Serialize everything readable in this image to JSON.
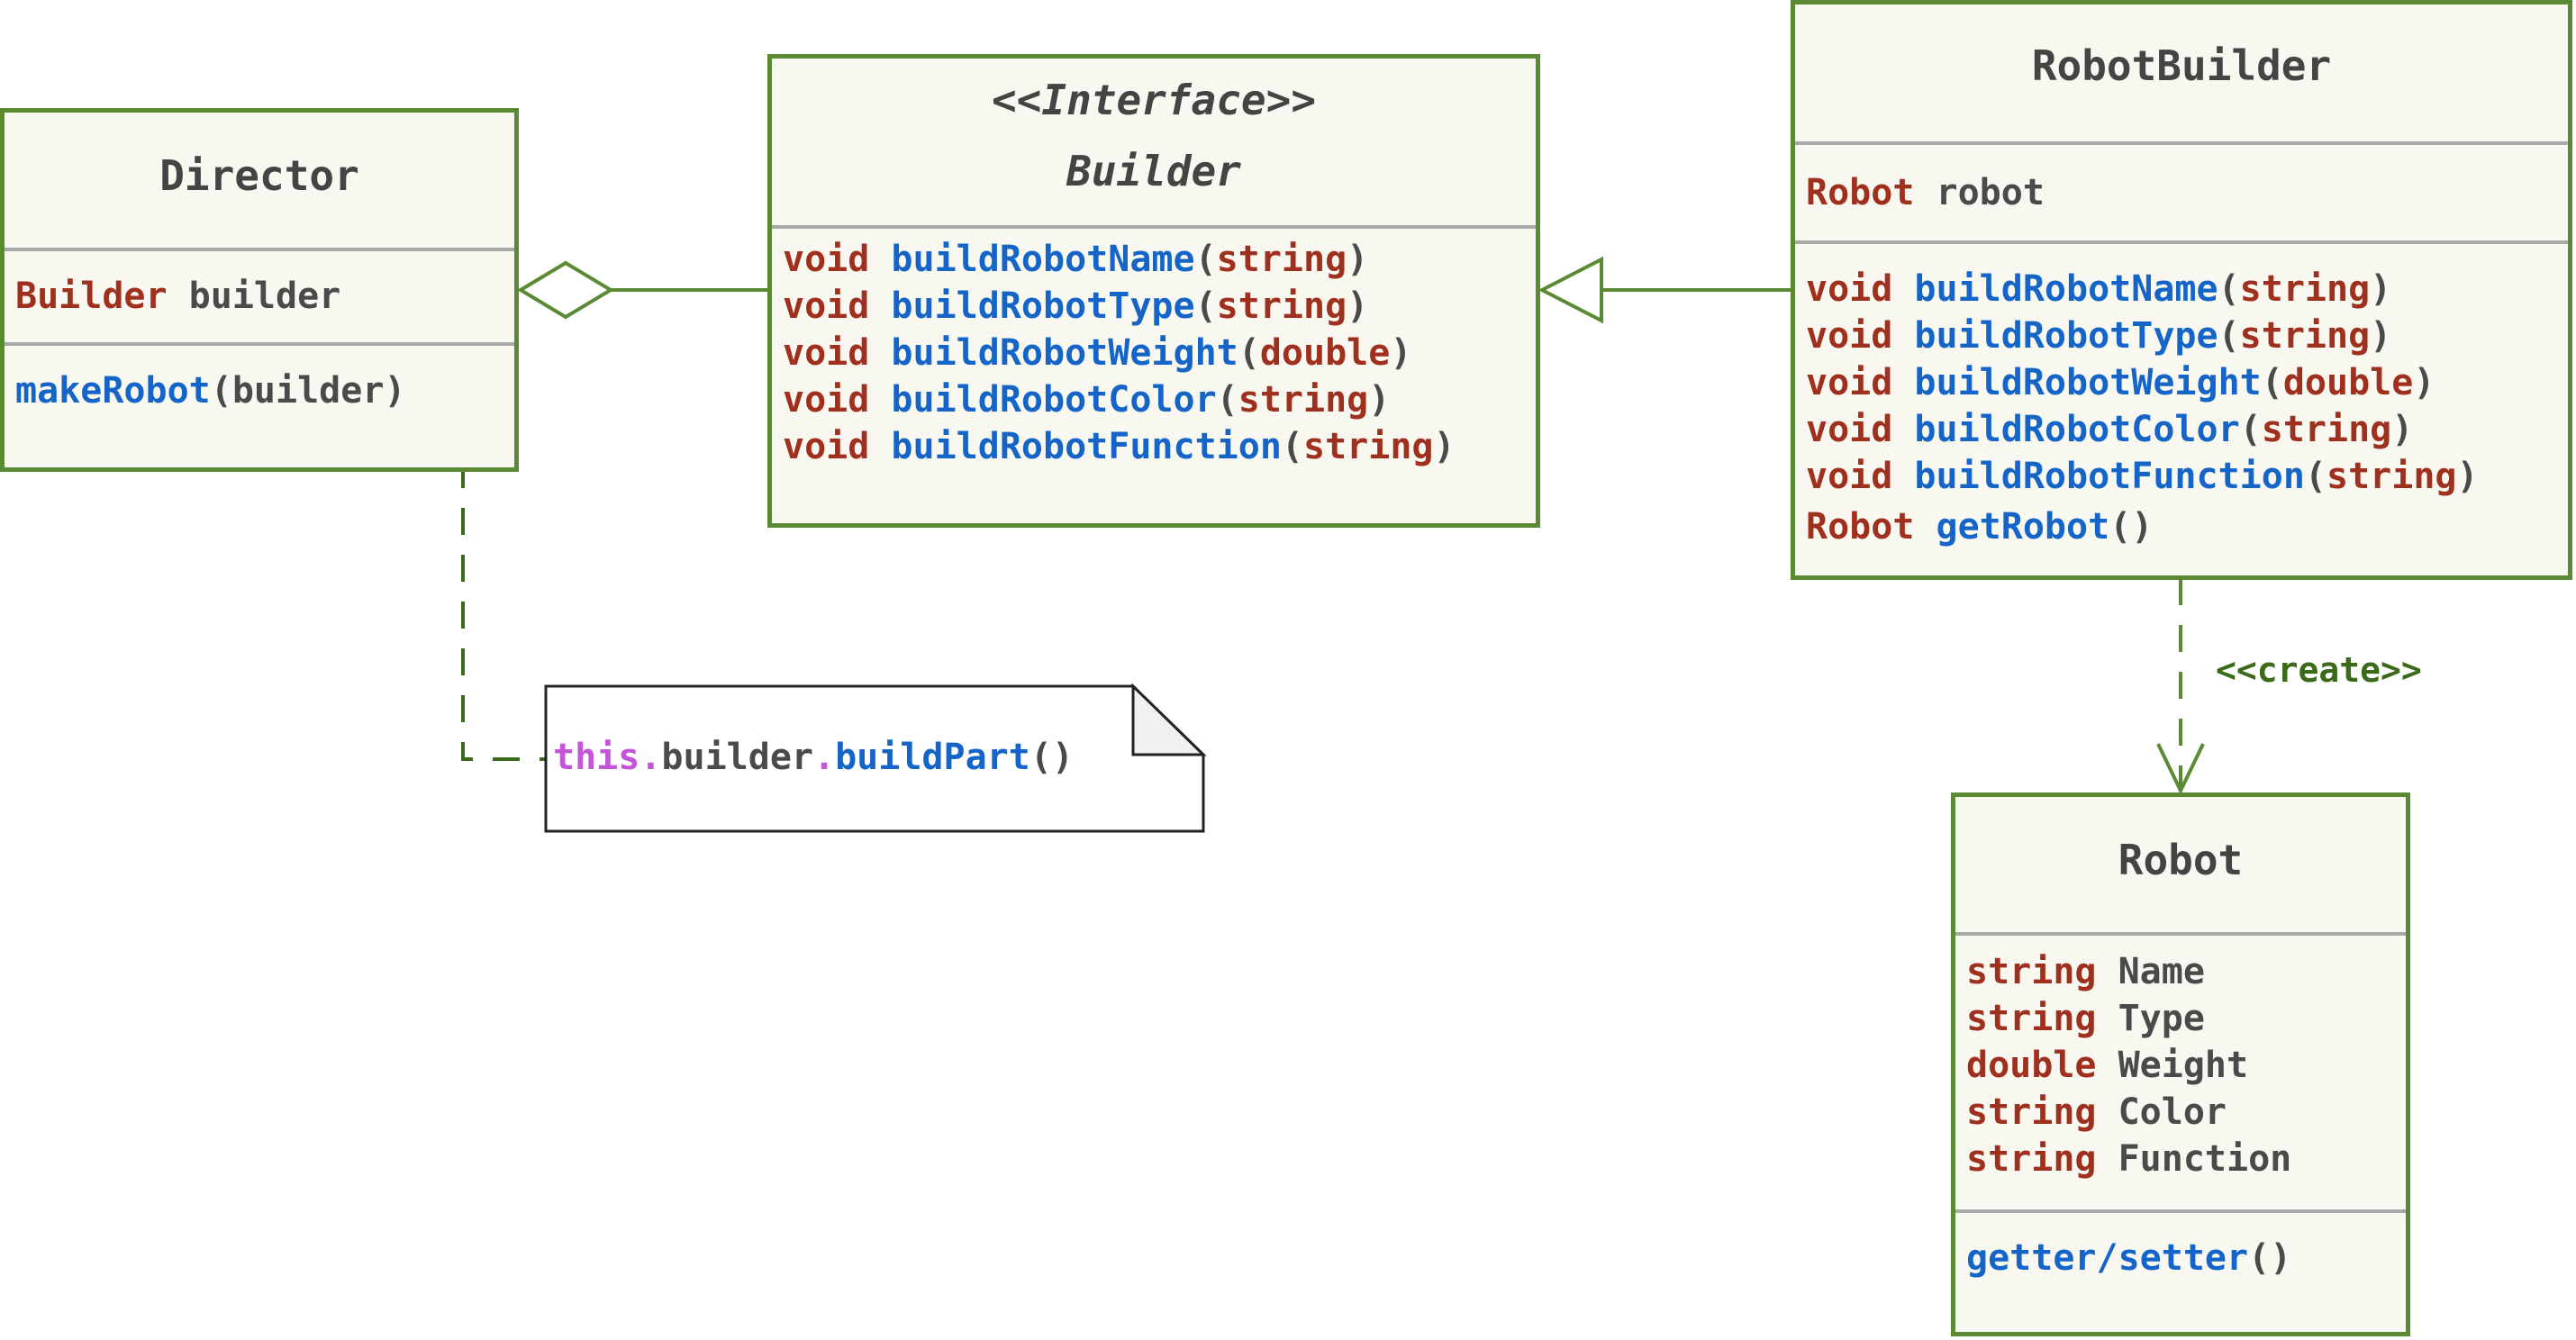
{
  "director": {
    "name": "Director",
    "attr_type": "Builder",
    "attr_name": "builder",
    "method_name": "makeRobot",
    "method_args": "(builder)"
  },
  "builder": {
    "stereotype": "<<Interface>>",
    "name": "Builder",
    "methods": [
      {
        "ret": "void",
        "name": "buildRobotName",
        "open": "(",
        "arg": "string",
        "close": ")"
      },
      {
        "ret": "void",
        "name": "buildRobotType",
        "open": "(",
        "arg": "string",
        "close": ")"
      },
      {
        "ret": "void",
        "name": "buildRobotWeight",
        "open": "(",
        "arg": "double",
        "close": ")"
      },
      {
        "ret": "void",
        "name": "buildRobotColor",
        "open": "(",
        "arg": "string",
        "close": ")"
      },
      {
        "ret": "void",
        "name": "buildRobotFunction",
        "open": "(",
        "arg": "string",
        "close": ")"
      }
    ]
  },
  "robot_builder": {
    "name": "RobotBuilder",
    "attr_type": "Robot",
    "attr_name": "robot",
    "methods": [
      {
        "ret": "void",
        "name": "buildRobotName",
        "open": "(",
        "arg": "string",
        "close": ")"
      },
      {
        "ret": "void",
        "name": "buildRobotType",
        "open": "(",
        "arg": "string",
        "close": ")"
      },
      {
        "ret": "void",
        "name": "buildRobotWeight",
        "open": "(",
        "arg": "double",
        "close": ")"
      },
      {
        "ret": "void",
        "name": "buildRobotColor",
        "open": "(",
        "arg": "string",
        "close": ")"
      },
      {
        "ret": "void",
        "name": "buildRobotFunction",
        "open": "(",
        "arg": "string",
        "close": ")"
      }
    ],
    "getter": {
      "ret": "Robot",
      "name": "getRobot",
      "args": "()"
    }
  },
  "robot": {
    "name": "Robot",
    "fields": [
      {
        "type": "string",
        "name": "Name"
      },
      {
        "type": "string",
        "name": "Type"
      },
      {
        "type": "double",
        "name": "Weight"
      },
      {
        "type": "string",
        "name": "Color"
      },
      {
        "type": "string",
        "name": "Function"
      }
    ],
    "method_name": "getter/setter",
    "method_args": "()"
  },
  "create_label": "<<create>>",
  "note": {
    "kw": "this",
    "dot1": ".",
    "obj": "builder",
    "dot2": ".",
    "fn": "buildPart",
    "args": "()"
  },
  "colors": {
    "class_border": "#5a8a33",
    "class_fill": "#f8f7f0",
    "keyword": "#a0301e",
    "function": "#1565c8",
    "text": "#4a4a4a",
    "this_keyword": "#c356d6",
    "stereotype_label": "#3b6b1a"
  }
}
